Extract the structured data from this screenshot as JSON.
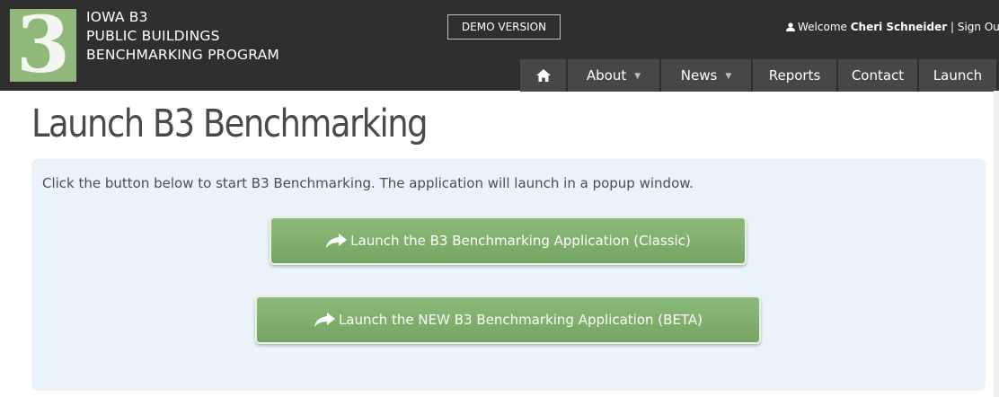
{
  "header": {
    "logo_text": "3",
    "brand_lines": [
      "IOWA B3",
      "PUBLIC BUILDINGS",
      "BENCHMARKING PROGRAM"
    ],
    "demo_label": "DEMO VERSION",
    "welcome_text": "Welcome",
    "user_name": "Cheri Schneider",
    "separator": "|",
    "sign_out": "Sign Ou",
    "colors": {
      "bar": "#2f2f2f",
      "nav": "#474747",
      "logo": "#8fb87a"
    }
  },
  "nav": {
    "home_icon": "home-icon",
    "items": [
      {
        "label": "About",
        "dropdown": true
      },
      {
        "label": "News",
        "dropdown": true
      },
      {
        "label": "Reports",
        "dropdown": false
      },
      {
        "label": "Contact",
        "dropdown": false
      },
      {
        "label": "Launch",
        "dropdown": false
      }
    ]
  },
  "main": {
    "title": "Launch B3 Benchmarking",
    "instructions": "Click the button below to start B3 Benchmarking. The application will launch in a popup window.",
    "buttons": [
      {
        "label": "Launch the B3 Benchmarking Application (Classic)",
        "icon": "share-arrow-icon"
      },
      {
        "label": "Launch the NEW B3 Benchmarking Application (BETA)",
        "icon": "share-arrow-icon"
      }
    ],
    "colors": {
      "panel": "#eaf2fa",
      "button": "#80af6d"
    }
  }
}
